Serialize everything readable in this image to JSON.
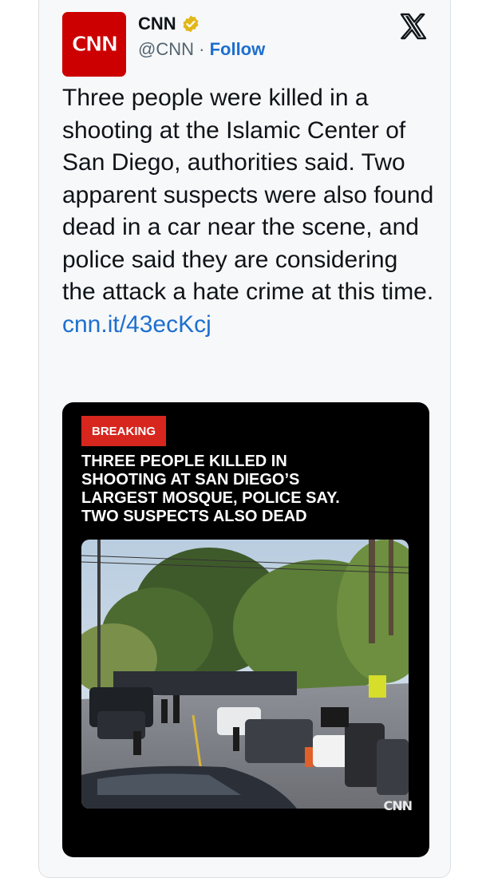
{
  "account": {
    "avatar_text": "CNN",
    "name": "CNN",
    "handle": "@CNN",
    "separator": "·",
    "follow_label": "Follow"
  },
  "tweet": {
    "text": "Three people were killed in a shooting at the Islamic Center of San Diego, authorities said. Two apparent suspects were also found dead in a car near the scene, and police said they are considering the attack a hate crime at this time.",
    "link": "cnn.it/43ecKcj"
  },
  "media": {
    "badge": "BREAKING",
    "headline_lines": [
      "THREE PEOPLE KILLED IN",
      "SHOOTING AT SAN DIEGO’S",
      "LARGEST MOSQUE, POLICE SAY.",
      "TWO SUSPECTS ALSO DEAD"
    ],
    "watermark": "CNN"
  },
  "icons": {
    "verified": "verified-badge-icon",
    "platform": "x-logo-icon"
  },
  "colors": {
    "brand_red": "#cc0000",
    "breaking_red": "#d7261e",
    "link_blue": "#1d6fcf",
    "verified_gold": "#e2b719"
  }
}
